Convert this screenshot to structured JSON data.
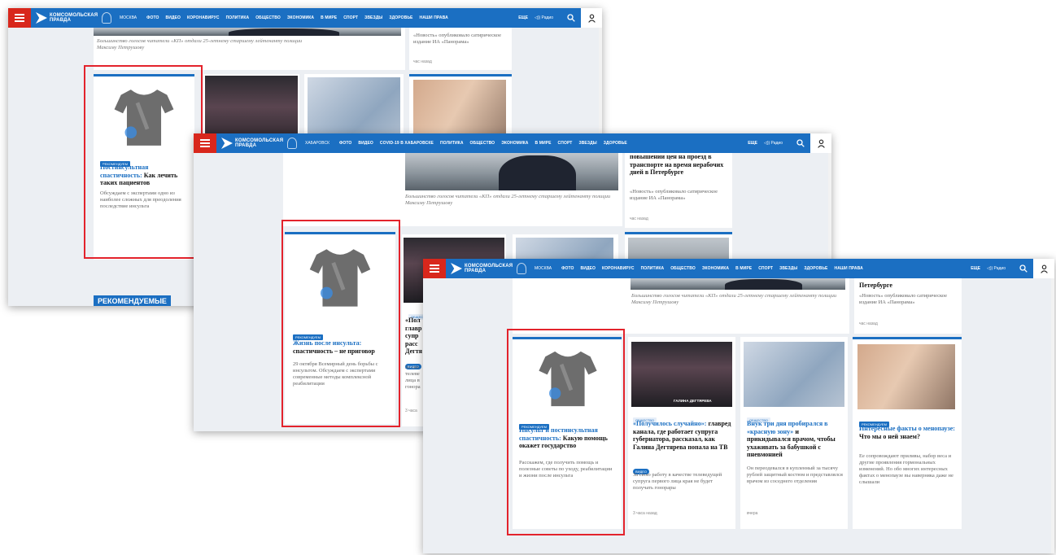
{
  "brand": {
    "logo_text": "КОМСОМОЛЬСКАЯ ПРАВДА"
  },
  "window1": {
    "city": "МОСКВА",
    "menu": [
      "ФОТО",
      "ВИДЕО",
      "КОРОНАВИРУС",
      "ПОЛИТИКА",
      "ОБЩЕСТВО",
      "ЭКОНОМИКА",
      "В МИРЕ",
      "СПОРТ",
      "ЗВЕЗДЫ",
      "ЗДОРОВЬЕ",
      "НАШИ ПРАВА"
    ],
    "more": "ЕЩЕ",
    "radio": "Радио",
    "caption": "Большинство голосов читатели «КП» отдали 25-летнему старшему лейтенанту полиции Максиму Петрушову",
    "news_snippet": "«Новость» опубликовало сатирическое издание ИА «Панорама»",
    "news_time": "час назад",
    "promo": {
      "badge": "РЕКОМЕНДУЕМ",
      "title_blue": "Постинсультная спастичность:",
      "title_black": "Как лечить таких пациентов",
      "lead": "Обсуждаем с экспертами одно из наиболее сложных для преодоления последствие инсульта"
    },
    "section": "РЕКОМЕНДУЕМЫЕ"
  },
  "window2": {
    "city": "ХАБАРОВСК",
    "menu": [
      "ФОТО",
      "ВИДЕО",
      "COVID-19 В ХАБАРОВСКЕ",
      "ПОЛИТИКА",
      "ОБЩЕСТВО",
      "ЭКОНОМИКА",
      "В МИРЕ",
      "СПОРТ",
      "ЗВЕЗДЫ",
      "ЗДОРОВЬЕ"
    ],
    "more": "ЕЩЕ",
    "radio": "Радио",
    "top_news": "повышении цен на проезд в транспорте на время нерабочих дней в Петербурге",
    "caption": "Большинство голосов читатели «КП» отдали 25-летнему старшему лейтенанту полиции Максиму Петрушову",
    "news_snippet": "«Новость» опубликовало сатирическое издание ИА «Панорама»",
    "news_time": "час назад",
    "promo": {
      "badge": "РЕКОМЕНДУЕМ",
      "title_blue": "Жизнь после инсульта:",
      "title_black": "спастичность – не приговор",
      "lead": "29 октября Всемирный день борьбы с инсультом. Обсуждаем с экспертами современные методы комплексной реабилитации"
    },
    "partial": {
      "badge": "ОБЩЕСТВ",
      "title": "«Пол главр супр расс Дегтя",
      "tag": "ВИДЕО",
      "lead": "За сво телеве лица в гонора",
      "time": "3 часа"
    }
  },
  "window3": {
    "city": "МОСКВА",
    "menu": [
      "ФОТО",
      "ВИДЕО",
      "КОРОНАВИРУС",
      "ПОЛИТИКА",
      "ОБЩЕСТВО",
      "ЭКОНОМИКА",
      "В МИРЕ",
      "СПОРТ",
      "ЗВЕЗДЫ",
      "ЗДОРОВЬЕ",
      "НАШИ ПРАВА"
    ],
    "more": "ЕЩЕ",
    "radio": "Радио",
    "top_news": "Петербурге",
    "caption": "Большинство голосов читатели «КП» отдали 25-летнему старшему лейтенанту полиции Максиму Петрушову",
    "news_snippet": "«Новость» опубликовало сатирическое издание ИА «Панорама»",
    "news_time": "час назад",
    "cards": [
      {
        "badge": "РЕКОМЕНДУЕМ",
        "title_blue": "Инсульт и постинсультная спастичность:",
        "title_black": "Какую помощь окажет государство",
        "lead": "Расскажем, где получить помощь и полезные советы по уходу, реабилитации и жизни после инсульта",
        "tag": "",
        "time": ""
      },
      {
        "badge": "ОБЩЕСТВО",
        "title_blue": "«Получилось случайно»:",
        "title_black": "главред канала, где работает супруга губернатора, рассказал, как Галина Дегтярева попала на ТВ",
        "tag": "ВИДЕО",
        "lead": "За свою работу в качестве телеведущей супруга первого лица края не будет получать гонорары",
        "time": "3 часа назад",
        "photo_text": "ГАЛИНА ДЕГТЯРЕВА"
      },
      {
        "badge": "ОБЩЕСТВО",
        "title_blue": "Внук три дня пробирался в «красную зону»",
        "title_black": "и прикидывался врачом, чтобы ухаживать за бабушкой с пневмонией",
        "tag": "",
        "lead": "Он переодевался в купленный за тысячу рублей защитный костюм и представлялся врачом из соседнего отделения",
        "time": "вчера"
      },
      {
        "badge": "РЕКОМЕНДУЕМ",
        "title_blue": "Интересные факты о менопаузе:",
        "title_black": "Что мы о ней знаем?",
        "tag": "",
        "lead": "Ее сопровождают приливы, набор веса и другие проявления гормональных изменений. Но обо многих интересных фактах о менопаузе вы наверняка даже не слышали",
        "time": ""
      }
    ]
  },
  "colors": {
    "brand_blue": "#1b6fc2",
    "brand_red": "#d8271c",
    "highlight": "#e3232c"
  }
}
